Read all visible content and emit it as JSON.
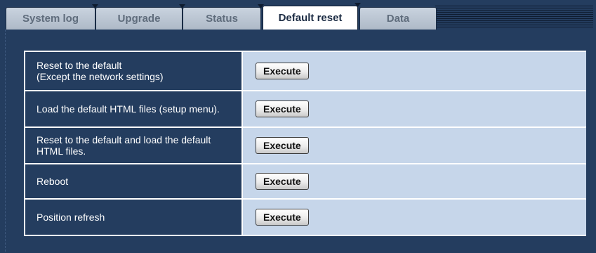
{
  "tabs": [
    {
      "label": "System log"
    },
    {
      "label": "Upgrade"
    },
    {
      "label": "Status"
    },
    {
      "label": "Default reset"
    },
    {
      "label": "Data"
    }
  ],
  "active_tab": "Default reset",
  "rows": [
    {
      "label": "Reset to the default\n(Except the network settings)",
      "button": "Execute"
    },
    {
      "label": "Load the default HTML files (setup menu).",
      "button": "Execute"
    },
    {
      "label": "Reset to the default and load the default\nHTML files.",
      "button": "Execute"
    },
    {
      "label": "Reboot",
      "button": "Execute"
    },
    {
      "label": "Position refresh",
      "button": "Execute"
    }
  ],
  "colors": {
    "background": "#243d5f",
    "label_cell": "#243d5f",
    "action_cell": "#c6d6ea",
    "tab_inactive": "#aeb9c7",
    "tab_active": "#ffffff"
  }
}
